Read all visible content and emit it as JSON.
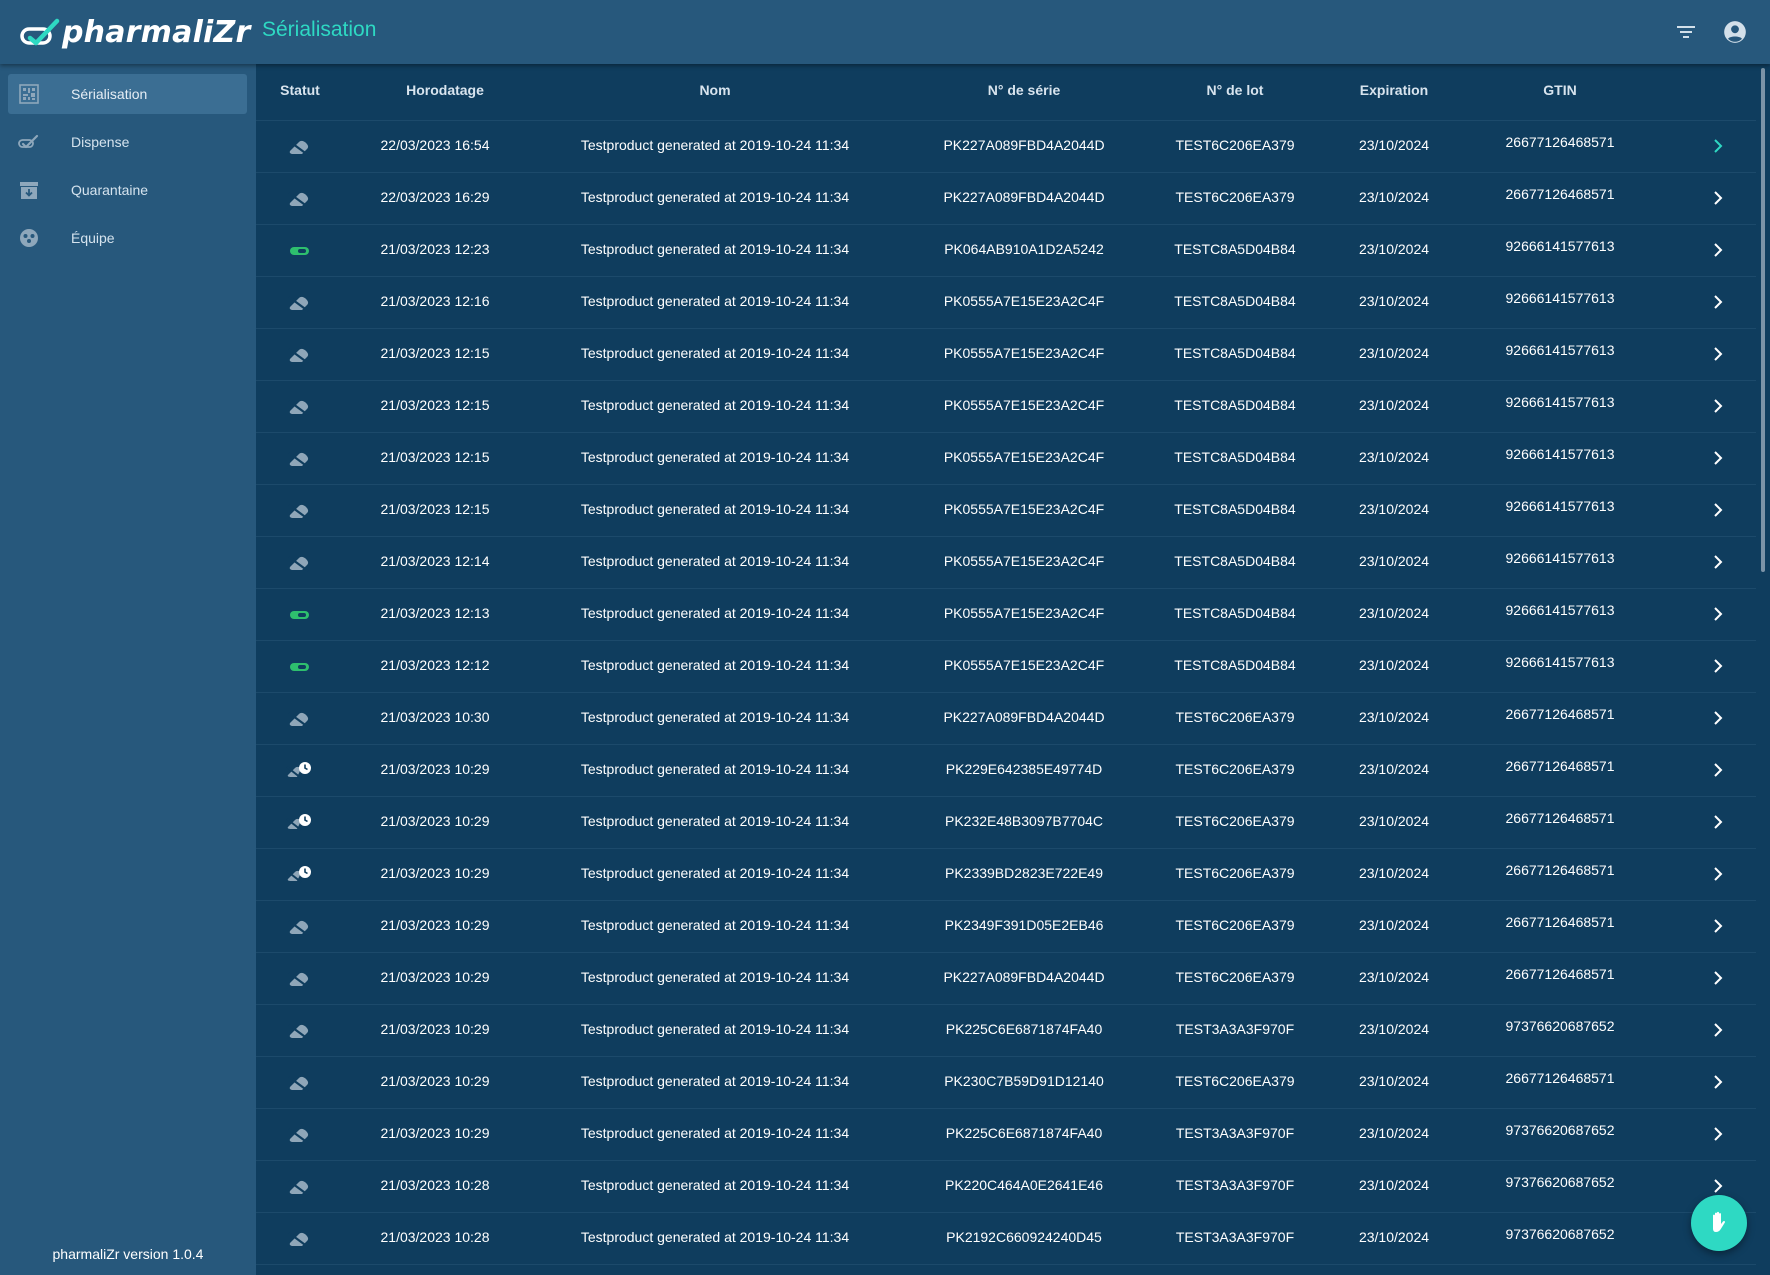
{
  "app": {
    "name": "pharmaliZr",
    "page_title": "Sérialisation"
  },
  "header": {
    "filter_icon": "filter-icon",
    "account_icon": "account-circle-icon"
  },
  "sidebar": {
    "items": [
      {
        "label": "Sérialisation",
        "icon": "serialization-icon",
        "active": true
      },
      {
        "label": "Dispense",
        "icon": "dispense-icon",
        "active": false
      },
      {
        "label": "Quarantaine",
        "icon": "quarantine-icon",
        "active": false
      },
      {
        "label": "Équipe",
        "icon": "team-icon",
        "active": false
      }
    ],
    "version": "pharmaliZr version 1.0.4"
  },
  "table": {
    "columns": [
      "Statut",
      "Horodatage",
      "Nom",
      "N° de série",
      "N° de lot",
      "Expiration",
      "GTIN"
    ],
    "rows": [
      {
        "status": "inactive",
        "timestamp": "22/03/2023 16:54",
        "name": "Testproduct generated at 2019-10-24 11:34",
        "serial": "PK227A089FBD4A2044D",
        "lot": "TEST6C206EA379",
        "expiration": "23/10/2024",
        "gtin": "26677126468571"
      },
      {
        "status": "inactive",
        "timestamp": "22/03/2023 16:29",
        "name": "Testproduct generated at 2019-10-24 11:34",
        "serial": "PK227A089FBD4A2044D",
        "lot": "TEST6C206EA379",
        "expiration": "23/10/2024",
        "gtin": "26677126468571"
      },
      {
        "status": "active",
        "timestamp": "21/03/2023 12:23",
        "name": "Testproduct generated at 2019-10-24 11:34",
        "serial": "PK064AB910A1D2A5242",
        "lot": "TESTC8A5D04B84",
        "expiration": "23/10/2024",
        "gtin": "92666141577613"
      },
      {
        "status": "inactive",
        "timestamp": "21/03/2023 12:16",
        "name": "Testproduct generated at 2019-10-24 11:34",
        "serial": "PK0555A7E15E23A2C4F",
        "lot": "TESTC8A5D04B84",
        "expiration": "23/10/2024",
        "gtin": "92666141577613"
      },
      {
        "status": "inactive",
        "timestamp": "21/03/2023 12:15",
        "name": "Testproduct generated at 2019-10-24 11:34",
        "serial": "PK0555A7E15E23A2C4F",
        "lot": "TESTC8A5D04B84",
        "expiration": "23/10/2024",
        "gtin": "92666141577613"
      },
      {
        "status": "inactive",
        "timestamp": "21/03/2023 12:15",
        "name": "Testproduct generated at 2019-10-24 11:34",
        "serial": "PK0555A7E15E23A2C4F",
        "lot": "TESTC8A5D04B84",
        "expiration": "23/10/2024",
        "gtin": "92666141577613"
      },
      {
        "status": "inactive",
        "timestamp": "21/03/2023 12:15",
        "name": "Testproduct generated at 2019-10-24 11:34",
        "serial": "PK0555A7E15E23A2C4F",
        "lot": "TESTC8A5D04B84",
        "expiration": "23/10/2024",
        "gtin": "92666141577613"
      },
      {
        "status": "inactive",
        "timestamp": "21/03/2023 12:15",
        "name": "Testproduct generated at 2019-10-24 11:34",
        "serial": "PK0555A7E15E23A2C4F",
        "lot": "TESTC8A5D04B84",
        "expiration": "23/10/2024",
        "gtin": "92666141577613"
      },
      {
        "status": "inactive",
        "timestamp": "21/03/2023 12:14",
        "name": "Testproduct generated at 2019-10-24 11:34",
        "serial": "PK0555A7E15E23A2C4F",
        "lot": "TESTC8A5D04B84",
        "expiration": "23/10/2024",
        "gtin": "92666141577613"
      },
      {
        "status": "active",
        "timestamp": "21/03/2023 12:13",
        "name": "Testproduct generated at 2019-10-24 11:34",
        "serial": "PK0555A7E15E23A2C4F",
        "lot": "TESTC8A5D04B84",
        "expiration": "23/10/2024",
        "gtin": "92666141577613"
      },
      {
        "status": "active",
        "timestamp": "21/03/2023 12:12",
        "name": "Testproduct generated at 2019-10-24 11:34",
        "serial": "PK0555A7E15E23A2C4F",
        "lot": "TESTC8A5D04B84",
        "expiration": "23/10/2024",
        "gtin": "92666141577613"
      },
      {
        "status": "inactive",
        "timestamp": "21/03/2023 10:30",
        "name": "Testproduct generated at 2019-10-24 11:34",
        "serial": "PK227A089FBD4A2044D",
        "lot": "TEST6C206EA379",
        "expiration": "23/10/2024",
        "gtin": "26677126468571"
      },
      {
        "status": "pending",
        "timestamp": "21/03/2023 10:29",
        "name": "Testproduct generated at 2019-10-24 11:34",
        "serial": "PK229E642385E49774D",
        "lot": "TEST6C206EA379",
        "expiration": "23/10/2024",
        "gtin": "26677126468571"
      },
      {
        "status": "pending",
        "timestamp": "21/03/2023 10:29",
        "name": "Testproduct generated at 2019-10-24 11:34",
        "serial": "PK232E48B3097B7704C",
        "lot": "TEST6C206EA379",
        "expiration": "23/10/2024",
        "gtin": "26677126468571"
      },
      {
        "status": "pending",
        "timestamp": "21/03/2023 10:29",
        "name": "Testproduct generated at 2019-10-24 11:34",
        "serial": "PK2339BD2823E722E49",
        "lot": "TEST6C206EA379",
        "expiration": "23/10/2024",
        "gtin": "26677126468571"
      },
      {
        "status": "inactive",
        "timestamp": "21/03/2023 10:29",
        "name": "Testproduct generated at 2019-10-24 11:34",
        "serial": "PK2349F391D05E2EB46",
        "lot": "TEST6C206EA379",
        "expiration": "23/10/2024",
        "gtin": "26677126468571"
      },
      {
        "status": "inactive",
        "timestamp": "21/03/2023 10:29",
        "name": "Testproduct generated at 2019-10-24 11:34",
        "serial": "PK227A089FBD4A2044D",
        "lot": "TEST6C206EA379",
        "expiration": "23/10/2024",
        "gtin": "26677126468571"
      },
      {
        "status": "inactive",
        "timestamp": "21/03/2023 10:29",
        "name": "Testproduct generated at 2019-10-24 11:34",
        "serial": "PK225C6E6871874FA40",
        "lot": "TEST3A3A3F970F",
        "expiration": "23/10/2024",
        "gtin": "97376620687652"
      },
      {
        "status": "inactive",
        "timestamp": "21/03/2023 10:29",
        "name": "Testproduct generated at 2019-10-24 11:34",
        "serial": "PK230C7B59D91D12140",
        "lot": "TEST6C206EA379",
        "expiration": "23/10/2024",
        "gtin": "26677126468571"
      },
      {
        "status": "inactive",
        "timestamp": "21/03/2023 10:29",
        "name": "Testproduct generated at 2019-10-24 11:34",
        "serial": "PK225C6E6871874FA40",
        "lot": "TEST3A3A3F970F",
        "expiration": "23/10/2024",
        "gtin": "97376620687652"
      },
      {
        "status": "inactive",
        "timestamp": "21/03/2023 10:28",
        "name": "Testproduct generated at 2019-10-24 11:34",
        "serial": "PK220C464A0E2641E46",
        "lot": "TEST3A3A3F970F",
        "expiration": "23/10/2024",
        "gtin": "97376620687652"
      },
      {
        "status": "inactive",
        "timestamp": "21/03/2023 10:28",
        "name": "Testproduct generated at 2019-10-24 11:34",
        "serial": "PK2192C660924240D45",
        "lot": "TEST3A3A3F970F",
        "expiration": "23/10/2024",
        "gtin": "97376620687652"
      }
    ]
  },
  "fab": {
    "icon": "hand-stop-icon"
  },
  "colors": {
    "background": "#0f3d5e",
    "toolbar": "#27587c",
    "accent": "#2ed9c3",
    "status_active": "#2ebf6e",
    "status_inactive": "#8fa6b8"
  }
}
